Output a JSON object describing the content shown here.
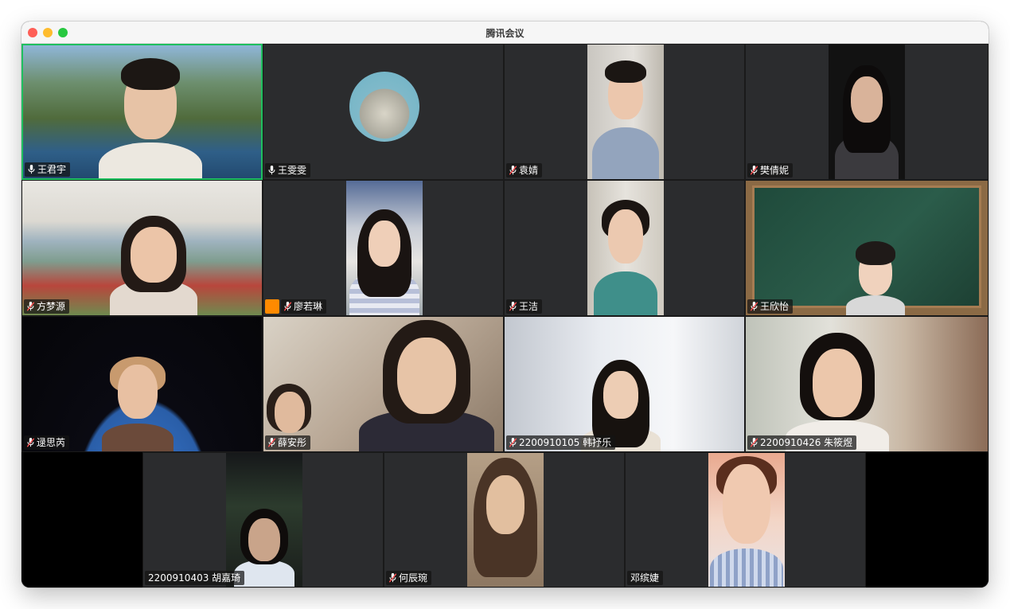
{
  "window": {
    "title": "腾讯会议"
  },
  "participants": [
    {
      "name": "王君宇",
      "mic": "on"
    },
    {
      "name": "王雯雯",
      "mic": "on"
    },
    {
      "name": "袁婧",
      "mic": "muted"
    },
    {
      "name": "樊倩妮",
      "mic": "muted"
    },
    {
      "name": "方梦源",
      "mic": "muted"
    },
    {
      "name": "廖若琳",
      "mic": "muted"
    },
    {
      "name": "王洁",
      "mic": "muted"
    },
    {
      "name": "王欣怡",
      "mic": "muted"
    },
    {
      "name": "逯思芮",
      "mic": "muted"
    },
    {
      "name": "薛安彤",
      "mic": "muted"
    },
    {
      "name": "2200910105 韩抒乐",
      "mic": "muted"
    },
    {
      "name": "2200910426 朱筱煜",
      "mic": "muted"
    },
    {
      "name": "2200910403 胡嘉琦",
      "mic": "none"
    },
    {
      "name": "何辰琬",
      "mic": "muted"
    },
    {
      "name": "邓缤婕",
      "mic": "none"
    }
  ],
  "colors": {
    "active_speaker_border": "#1fbf5f",
    "tile_background": "#2b2c2e",
    "avatar_badge": "#ff8a00"
  }
}
